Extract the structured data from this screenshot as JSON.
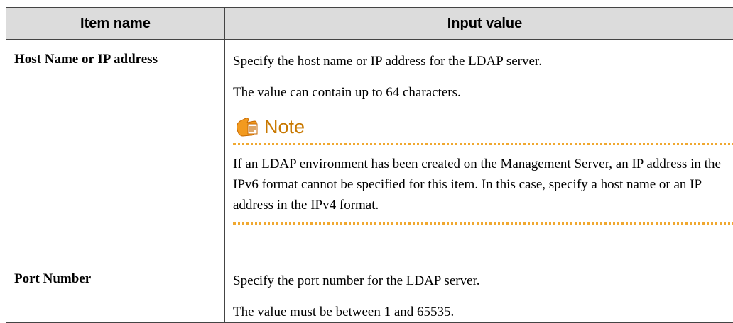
{
  "table": {
    "headers": [
      "Item name",
      "Input value"
    ],
    "rows": [
      {
        "name": "Host Name or IP address",
        "paragraphs": [
          "Specify the host name or IP address for the LDAP server.",
          "The value can contain up to 64 characters."
        ],
        "note": {
          "title": "Note",
          "icon": "note-hand-icon",
          "text": "If an LDAP environment has been created on the Management Server, an IP address in the IPv6 format cannot be specified for this item. In this case, specify a host name or an IP address in the IPv4 format."
        }
      },
      {
        "name": "Port Number",
        "paragraphs": [
          "Specify the port number for the LDAP server.",
          "The value must be between 1 and 65535."
        ]
      }
    ]
  },
  "colors": {
    "header_bg": "#dcdcdc",
    "note_title": "#c87800",
    "note_rule": "#f0a830"
  }
}
